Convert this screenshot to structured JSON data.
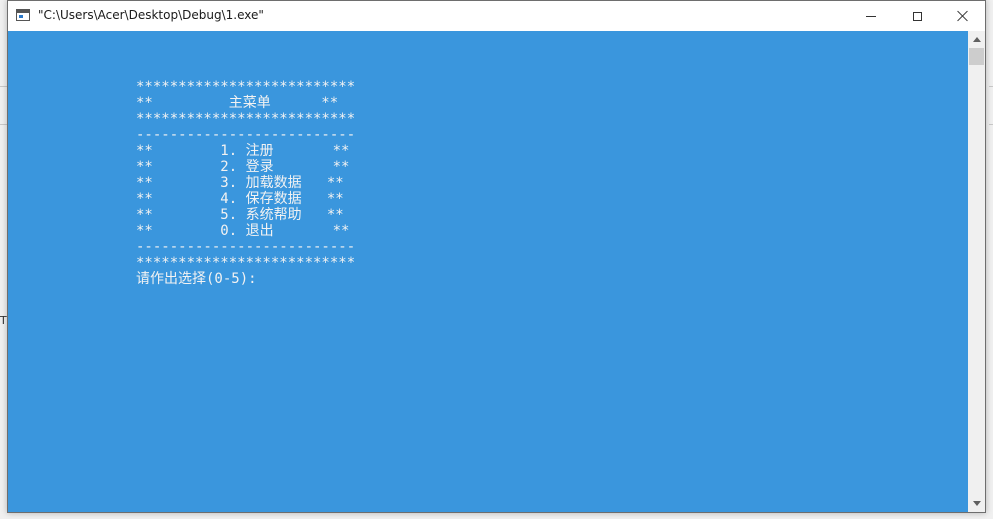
{
  "window": {
    "title": "\"C:\\Users\\Acer\\Desktop\\Debug\\1.exe\""
  },
  "background": {
    "left_glyph": "T"
  },
  "console": {
    "lines": [
      "**************************",
      "**         主菜单      **",
      "**************************",
      "--------------------------",
      "**        1. 注册       **",
      "**        2. 登录       **",
      "**        3. 加载数据   **",
      "**        4. 保存数据   **",
      "**        5. 系统帮助   **",
      "**        0. 退出       **",
      "--------------------------",
      "**************************"
    ],
    "prompt": "请作出选择(0-5):"
  },
  "colors": {
    "console_bg": "#3a96dd",
    "console_fg": "#f2f2f2"
  },
  "icons": {
    "app": "console-app-icon",
    "minimize": "minimize-icon",
    "maximize": "maximize-icon",
    "close": "close-icon",
    "scroll_up": "scroll-up-arrow-icon",
    "scroll_down": "scroll-down-arrow-icon"
  }
}
